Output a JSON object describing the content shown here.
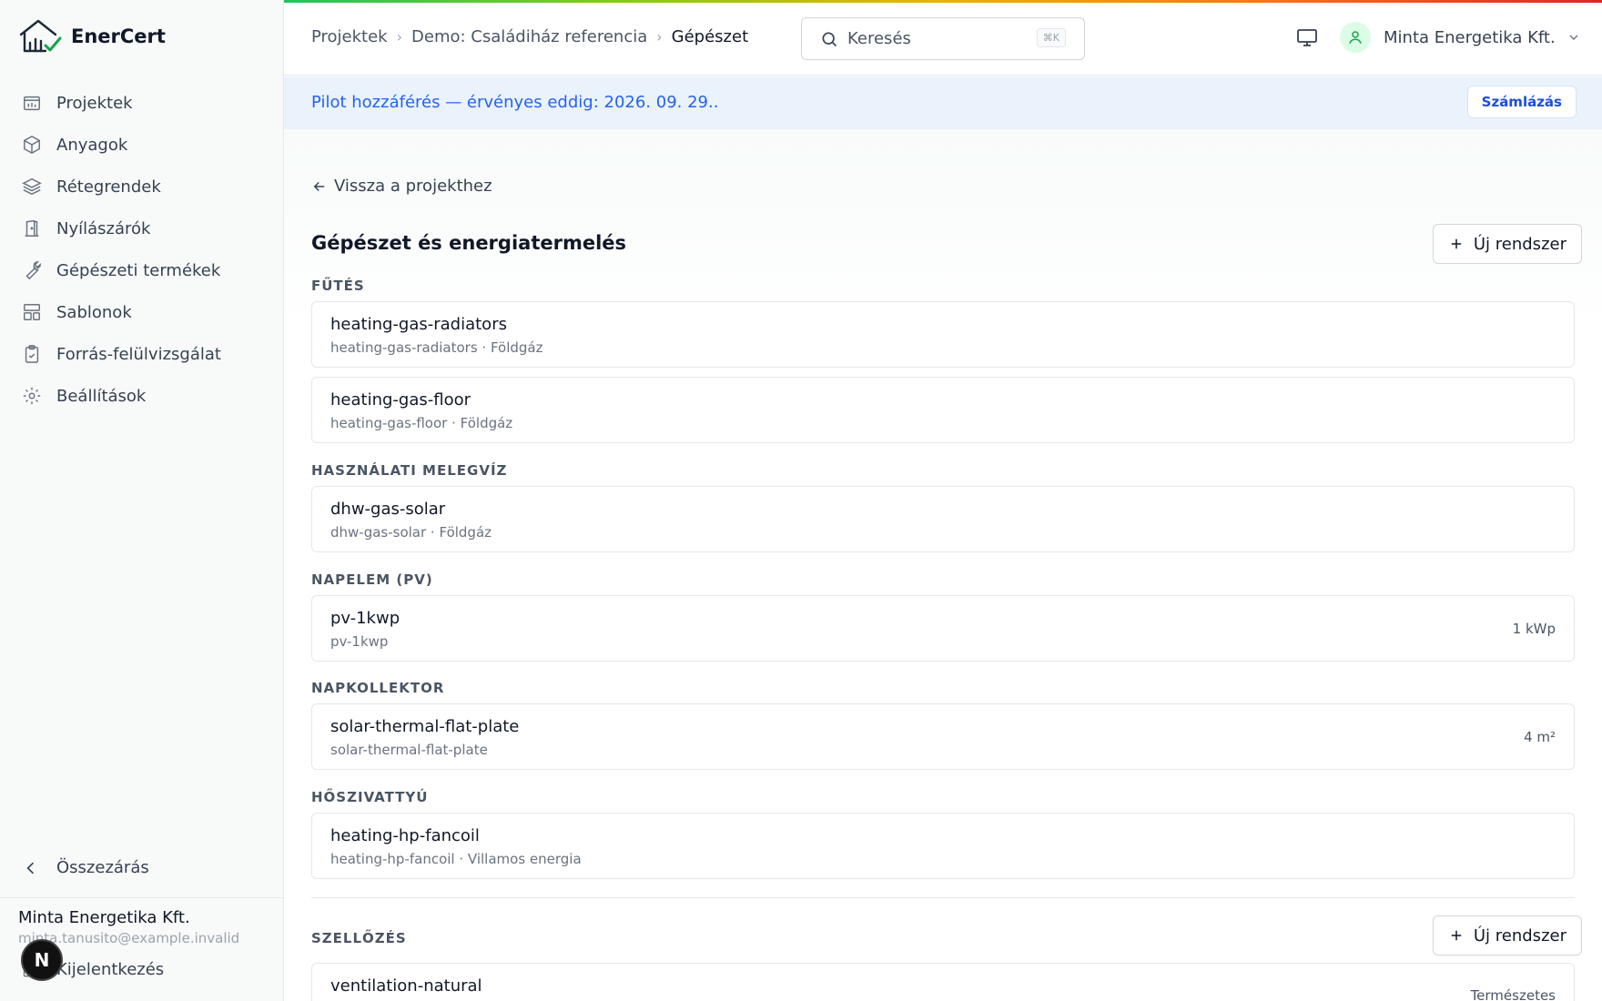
{
  "app": {
    "name": "EnerCert"
  },
  "sidebar": {
    "items": [
      {
        "label": "Projektek",
        "icon": "projects-icon"
      },
      {
        "label": "Anyagok",
        "icon": "box-icon"
      },
      {
        "label": "Rétegrendek",
        "icon": "layers-icon"
      },
      {
        "label": "Nyílászárók",
        "icon": "door-icon"
      },
      {
        "label": "Gépészeti termékek",
        "icon": "wrench-icon"
      },
      {
        "label": "Sablonok",
        "icon": "template-icon"
      },
      {
        "label": "Forrás-felülvizsgálat",
        "icon": "clipboard-check-icon"
      },
      {
        "label": "Beállítások",
        "icon": "gear-icon"
      }
    ],
    "collapse_label": "Összezárás",
    "user_name": "Minta Energetika Kft.",
    "user_email": "minta.tanusito@example.invalid",
    "logout_label": "Kijelentkezés",
    "badge_letter": "N"
  },
  "topbar": {
    "breadcrumb": [
      "Projektek",
      "Demo: Családiház referencia",
      "Gépészet"
    ],
    "search_placeholder": "Keresés",
    "search_shortcut": "⌘K",
    "account_name": "Minta Energetika Kft."
  },
  "banner": {
    "text": "Pilot hozzáférés — érvényes eddig: 2026. 09. 29..",
    "billing_label": "Számlázás"
  },
  "main": {
    "back_label": "Vissza a projekthez",
    "title": "Gépészet és energiatermelés",
    "new_system_label": "Új rendszer",
    "sections": [
      {
        "label": "FŰTÉS",
        "items": [
          {
            "title": "heating-gas-radiators",
            "subtitle": "heating-gas-radiators · Földgáz",
            "value": ""
          },
          {
            "title": "heating-gas-floor",
            "subtitle": "heating-gas-floor · Földgáz",
            "value": ""
          }
        ]
      },
      {
        "label": "HASZNÁLATI MELEGVÍZ",
        "items": [
          {
            "title": "dhw-gas-solar",
            "subtitle": "dhw-gas-solar · Földgáz",
            "value": ""
          }
        ]
      },
      {
        "label": "NAPELEM (PV)",
        "items": [
          {
            "title": "pv-1kwp",
            "subtitle": "pv-1kwp",
            "value": "1 kWp"
          }
        ]
      },
      {
        "label": "NAPKOLLEKTOR",
        "items": [
          {
            "title": "solar-thermal-flat-plate",
            "subtitle": "solar-thermal-flat-plate",
            "value": "4 m²"
          }
        ]
      },
      {
        "label": "HŐSZIVATTYÚ",
        "items": [
          {
            "title": "heating-hp-fancoil",
            "subtitle": "heating-hp-fancoil · Villamos energia",
            "value": ""
          }
        ]
      }
    ],
    "ventilation": {
      "label": "SZELLŐZÉS",
      "new_system_label": "Új rendszer",
      "items": [
        {
          "title": "ventilation-natural",
          "value": "Természetes"
        }
      ]
    }
  },
  "colors": {
    "accent": "#2563eb",
    "brand_green": "#16a34a",
    "banner_bg": "#eaf2fc"
  }
}
